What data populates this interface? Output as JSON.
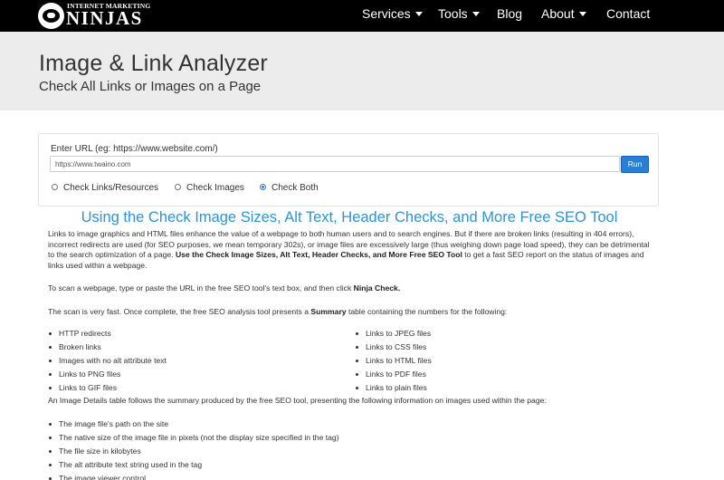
{
  "nav": {
    "logo_top": "INTERNET MARKETING",
    "logo_main": "NINJAS",
    "items": [
      {
        "label": "Services",
        "dropdown": true
      },
      {
        "label": "Tools",
        "dropdown": true
      },
      {
        "label": "Blog",
        "dropdown": false
      },
      {
        "label": "About",
        "dropdown": true
      },
      {
        "label": "Contact",
        "dropdown": false
      }
    ]
  },
  "header": {
    "title": "Image & Link Analyzer",
    "subtitle": "Check All Links or Images on a Page"
  },
  "form": {
    "url_label": "Enter URL (eg: https://www.website.com/)",
    "url_value": "https://www.twaino.com",
    "run_label": "Run",
    "options": [
      {
        "label": "Check Links/Resources",
        "checked": false
      },
      {
        "label": "Check Images",
        "checked": false
      },
      {
        "label": "Check Both",
        "checked": true
      }
    ]
  },
  "content": {
    "heading": "Using the Check Image Sizes, Alt Text, Header Checks, and More Free SEO Tool",
    "intro_plain": "Links to image graphics and HTML files enhance the value of a webpage to both human users and to search engines. But if there are broken links (resulting in 404 errors), incorrect redirects are used (for SEO purposes, we mean temporary 302s), or image files are excessively large (thus weighing down page load speed), they can be detrimental to the search optimization of a page. ",
    "intro_bold": "Use the Check Image Sizes, Alt Text, Header Checks, and More Free SEO Tool",
    "intro_end": " to get a fast SEO report on the status of images and links used within a webpage.",
    "scan_plain": "To scan a webpage, type or paste the URL in the free SEO tool's text box, and then click ",
    "scan_bold": "Ninja Check.",
    "fast_plain": "The scan is very fast. Once complete, the free SEO analysis tool presents a ",
    "fast_bold": "Summary",
    "fast_end": " table containing the numbers for the following:",
    "summary_left": [
      "HTTP redirects",
      "Broken links",
      "Images with no alt attribute text",
      "Links to PNG files",
      "Links to GIF files"
    ],
    "summary_right": [
      "Links to JPEG files",
      "Links to CSS files",
      "Links to HTML files",
      "Links to PDF files",
      "Links to plain files"
    ],
    "details_intro": "An Image Details table follows the summary produced by the free SEO tool, presenting the following information on images used within the page:",
    "details_items": [
      "The image file's path on the site",
      "The native size of the image file in pixels (not the display size specified in the tag)",
      "The file size in kilobytes",
      "The alt attribute text string used in the tag",
      "The image viewer control"
    ]
  },
  "colors": {
    "nav_bg": "#000000",
    "header_band": "#ececec",
    "accent": "#2d93d8",
    "button": "#2680d8"
  }
}
